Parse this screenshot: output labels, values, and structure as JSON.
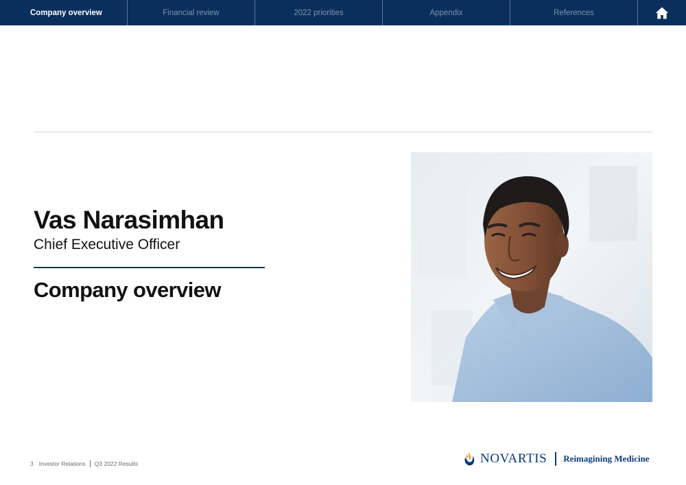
{
  "nav": {
    "tabs": [
      {
        "label": "Company overview"
      },
      {
        "label": "Financial review"
      },
      {
        "label": "2022 priorities"
      },
      {
        "label": "Appendix"
      },
      {
        "label": "References"
      }
    ],
    "home_icon": "home-icon",
    "active_color": "#ffffff",
    "bar_color": "#0a2f5c"
  },
  "slide": {
    "speaker_name": "Vas Narasimhan",
    "speaker_title": "Chief Executive Officer",
    "section_title": "Company overview",
    "photo": "portrait-photo"
  },
  "footer": {
    "page_number": "3",
    "department": "Investor Relations",
    "report": "Q3 2022 Results"
  },
  "brand": {
    "logo_name": "NOVARTIS",
    "tagline": "Reimagining Medicine",
    "brand_color": "#0a3a7a"
  }
}
